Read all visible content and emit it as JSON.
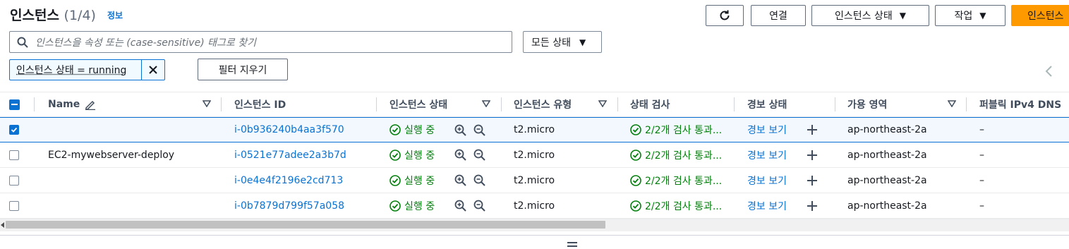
{
  "header": {
    "title": "인스턴스",
    "count": "(1/4)",
    "info_link": "정보",
    "buttons": {
      "connect": "연결",
      "instance_state": "인스턴스 상태",
      "actions": "작업",
      "launch": "인스턴스"
    }
  },
  "filter": {
    "search_placeholder": "인스턴스을 속성 또는 (case-sensitive) 태그로 찾기",
    "state_select": "모든 상태",
    "token": "인스턴스 상태 = running",
    "clear_filters": "필터 지우기"
  },
  "table": {
    "columns": [
      "Name",
      "인스턴스 ID",
      "인스턴스 상태",
      "인스턴스 유형",
      "상태 검사",
      "경보 상태",
      "가용 영역",
      "퍼블릭 IPv4 DNS"
    ],
    "rows": [
      {
        "selected": true,
        "name": "",
        "id": "i-0b936240b4aa3f570",
        "state": "실행 중",
        "type": "t2.micro",
        "status_check": "2/2개 검사 통과...",
        "alarm": "경보 보기",
        "az": "ap-northeast-2a",
        "dns": "–"
      },
      {
        "selected": false,
        "name": "EC2-mywebserver-deploy",
        "id": "i-0521e77adee2a3b7d",
        "state": "실행 중",
        "type": "t2.micro",
        "status_check": "2/2개 검사 통과...",
        "alarm": "경보 보기",
        "az": "ap-northeast-2a",
        "dns": "–"
      },
      {
        "selected": false,
        "name": "",
        "id": "i-0e4e4f2196e2cd713",
        "state": "실행 중",
        "type": "t2.micro",
        "status_check": "2/2개 검사 통과...",
        "alarm": "경보 보기",
        "az": "ap-northeast-2a",
        "dns": "–"
      },
      {
        "selected": false,
        "name": "",
        "id": "i-0b7879d799f57a058",
        "state": "실행 중",
        "type": "t2.micro",
        "status_check": "2/2개 검사 통과...",
        "alarm": "경보 보기",
        "az": "ap-northeast-2a",
        "dns": "–"
      }
    ]
  },
  "colors": {
    "link": "#0972d3",
    "success": "#037f0c",
    "primary_button": "#ff9900",
    "selected_row": "#f2f8fd"
  }
}
